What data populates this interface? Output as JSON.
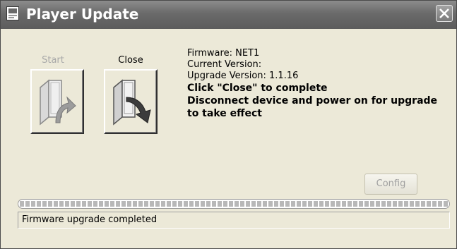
{
  "window": {
    "title": "Player Update"
  },
  "buttons": {
    "start_label": "Start",
    "close_label": "Close",
    "config_label": "Config"
  },
  "info": {
    "firmware": "Firmware: NET1",
    "current_version": "Current Version:",
    "upgrade_version": "Upgrade Version: 1.1.16",
    "instruction_1": "Click \"Close\" to complete",
    "instruction_2": "Disconnect device and power on for upgrade",
    "instruction_3": "to take effect"
  },
  "progress": {
    "percent": 100
  },
  "status": {
    "text": "Firmware upgrade completed"
  },
  "colors": {
    "titlebar": "#6a6a6a",
    "dialog_bg": "#ece9d8",
    "disabled_text": "#a8a8a8"
  },
  "icons": {
    "title": "app-icon",
    "close": "close-x-icon",
    "start": "folder-arrow-up-icon",
    "close_action": "folder-arrow-down-icon"
  }
}
